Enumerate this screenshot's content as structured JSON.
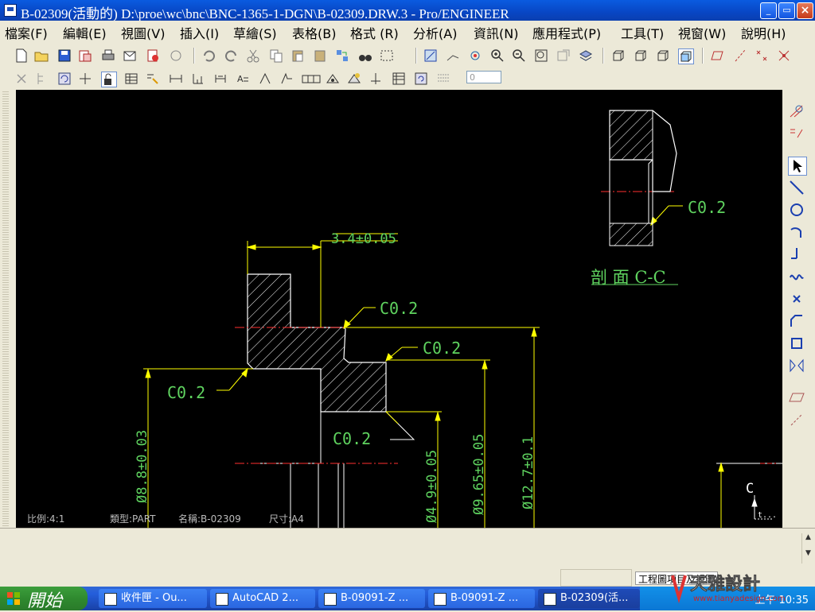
{
  "window": {
    "title": "B-02309(活動的) D:\\proe\\wc\\bnc\\BNC-1365-1-DGN\\B-02309.DRW.3 - Pro/ENGINEER",
    "controls": {
      "minimize": "_",
      "maximize": "▭",
      "close": "×"
    }
  },
  "menu": [
    "檔案(F)",
    "編輯(E)",
    "視圖(V)",
    "插入(I)",
    "草繪(S)",
    "表格(B)",
    "格式 (R)",
    "分析(A)",
    "資訊(N)",
    "應用程式(P)",
    "工具(T)",
    "視窗(W)",
    "說明(H)"
  ],
  "toolbar": {
    "zoom_field_value": "0"
  },
  "drawing": {
    "section_label": "剖 面 C-C",
    "dim_width": "3.4±0.05",
    "chamfers": [
      "C0.2",
      "C0.2",
      "C0.2",
      "C0.2",
      "C0.2"
    ],
    "dia_1": "Ø8.8±0.03",
    "dia_2": "Ø4.9±0.05",
    "dia_3": "Ø9.65±0.05",
    "dia_4": "Ø12.7±0.1",
    "cut_letter": "C",
    "cut_arrow_end": "t...",
    "footer": {
      "scale": "比例:4:1",
      "type": "類型:PART",
      "name": "名稱:B-02309",
      "size": "尺寸:A4"
    }
  },
  "status": {
    "tab": "工程圖項目及視圖"
  },
  "taskbar": {
    "start": "開始",
    "tasks": [
      "收件匣 - Ou...",
      "AutoCAD 2...",
      "B-09091-Z ...",
      "B-09091-Z ...",
      "B-02309(活..."
    ],
    "clock": "上午 10:35"
  },
  "watermark": {
    "brand": "天雅設計",
    "url": "www.tianyadesign.com"
  },
  "colors": {
    "dim": "#ffff00",
    "text": "#5fd35f",
    "geometry": "#ffffff",
    "centerline": "#ff3030"
  }
}
